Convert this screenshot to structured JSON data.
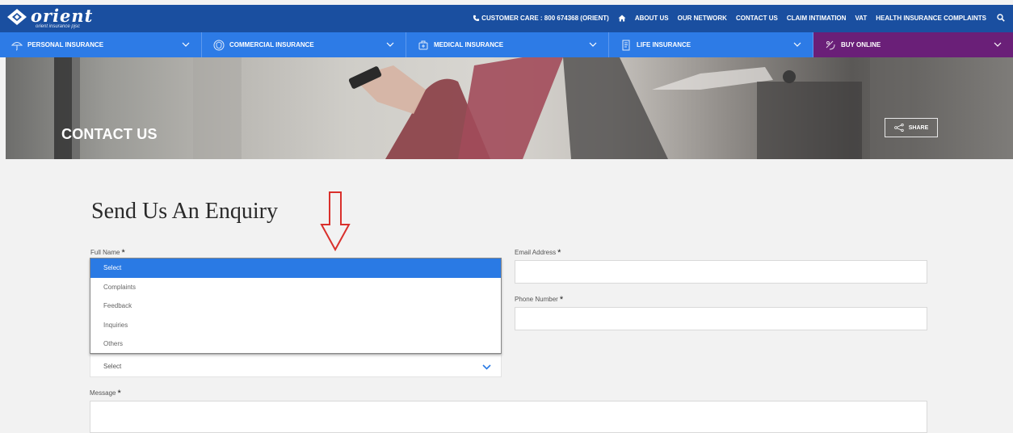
{
  "brand": {
    "name": "orient",
    "tagline": "orient insurance pjsc"
  },
  "topbar": {
    "customer_care": "CUSTOMER CARE : 800 674368 (ORIENT)",
    "links": [
      "ABOUT US",
      "OUR NETWORK",
      "CONTACT US",
      "CLAIM INTIMATION",
      "VAT",
      "HEALTH INSURANCE COMPLAINTS"
    ],
    "icons": [
      "phone-icon",
      "home-icon",
      "search-icon"
    ]
  },
  "nav": {
    "items": [
      {
        "label": "PERSONAL INSURANCE",
        "icon": "umbrella-icon"
      },
      {
        "label": "COMMERCIAL INSURANCE",
        "icon": "shield-icon"
      },
      {
        "label": "MEDICAL INSURANCE",
        "icon": "medical-icon"
      },
      {
        "label": "LIFE INSURANCE",
        "icon": "document-icon"
      },
      {
        "label": "BUY ONLINE",
        "icon": "cart-icon"
      }
    ]
  },
  "hero": {
    "title": "CONTACT US",
    "share_label": "SHARE"
  },
  "form": {
    "title": "Send Us An Enquiry",
    "full_name_label": "Full Name",
    "email_label": "Email Address",
    "phone_label": "Phone Number",
    "message_label": "Message",
    "required_mark": "*",
    "enquiry_type": {
      "selected": "Select",
      "options": [
        "Select",
        "Complaints",
        "Feedback",
        "Inquiries",
        "Others"
      ]
    }
  },
  "colors": {
    "topbar": "#1a4fa0",
    "nav": "#2d7be6",
    "buy_online": "#6a1f78",
    "highlight": "#2a7ae4",
    "arrow": "#d9302c"
  }
}
